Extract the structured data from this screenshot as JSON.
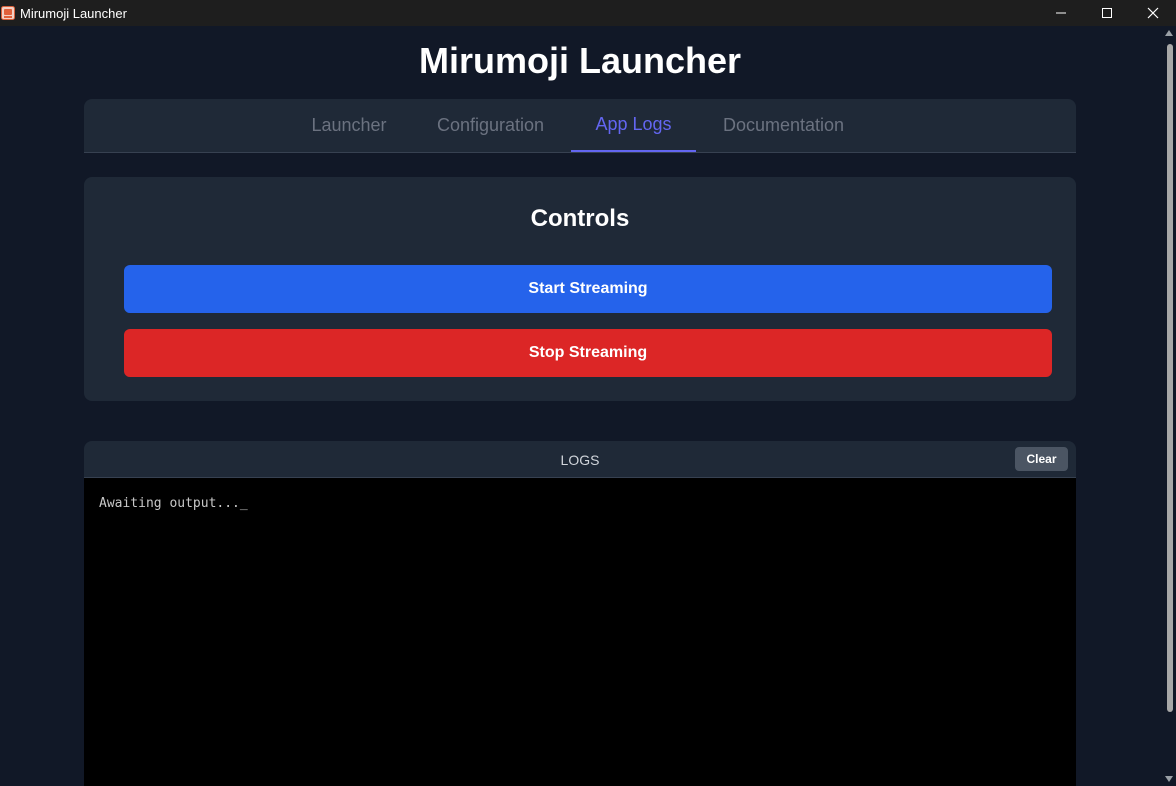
{
  "window": {
    "title": "Mirumoji Launcher",
    "controls": {
      "minimize": "minimize-icon",
      "maximize": "maximize-icon",
      "close": "close-icon"
    }
  },
  "header": {
    "title": "Mirumoji Launcher"
  },
  "tabs": [
    {
      "label": "Launcher",
      "active": false
    },
    {
      "label": "Configuration",
      "active": false
    },
    {
      "label": "App Logs",
      "active": true
    },
    {
      "label": "Documentation",
      "active": false
    }
  ],
  "controls": {
    "title": "Controls",
    "start_label": "Start Streaming",
    "stop_label": "Stop Streaming"
  },
  "logs": {
    "title": "LOGS",
    "clear_label": "Clear",
    "output": "Awaiting output..._"
  },
  "colors": {
    "background": "#111827",
    "card": "#1f2937",
    "accent": "#6366f1",
    "start": "#2563eb",
    "stop": "#dc2626",
    "log_bg": "#000000"
  }
}
